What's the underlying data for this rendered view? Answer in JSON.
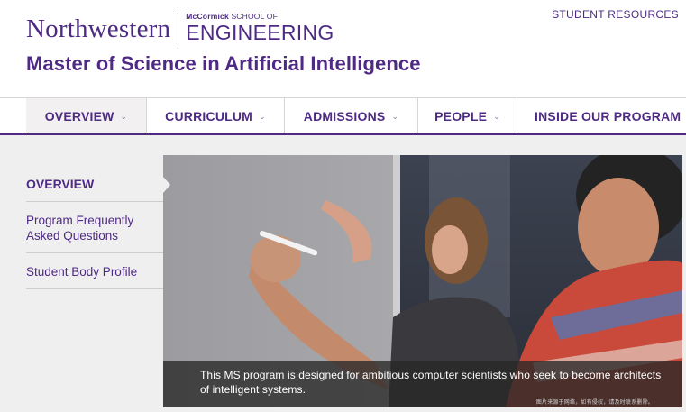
{
  "header": {
    "logo_university": "Northwestern",
    "logo_school_prefix": "McCormick",
    "logo_school_suffix": "SCHOOL OF",
    "logo_school_name": "ENGINEERING",
    "student_resources": "STUDENT RESOURCES",
    "site_title": "Master of Science in Artificial Intelligence"
  },
  "nav": {
    "items": [
      {
        "label": "OVERVIEW",
        "active": true,
        "has_dropdown": true
      },
      {
        "label": "CURRICULUM",
        "active": false,
        "has_dropdown": true
      },
      {
        "label": "ADMISSIONS",
        "active": false,
        "has_dropdown": true
      },
      {
        "label": "PEOPLE",
        "active": false,
        "has_dropdown": true
      },
      {
        "label": "INSIDE OUR PROGRAM",
        "active": false,
        "has_dropdown": false
      }
    ],
    "chevron_icon": "chevron-down-icon"
  },
  "subnav": {
    "items": [
      {
        "label": "OVERVIEW",
        "active": true
      },
      {
        "label": "Program Frequently Asked Questions",
        "active": false
      },
      {
        "label": "Student Body Profile",
        "active": false
      }
    ]
  },
  "hero": {
    "caption": "This MS program is designed for ambitious computer scientists who seek to become architects of intelligent systems.",
    "watermark": "图片来源于网络，如有侵权，请及时联系删除。"
  },
  "colors": {
    "brand_purple": "#4e2a84",
    "panel_gray": "#f0efef",
    "caption_bg": "#282828"
  }
}
